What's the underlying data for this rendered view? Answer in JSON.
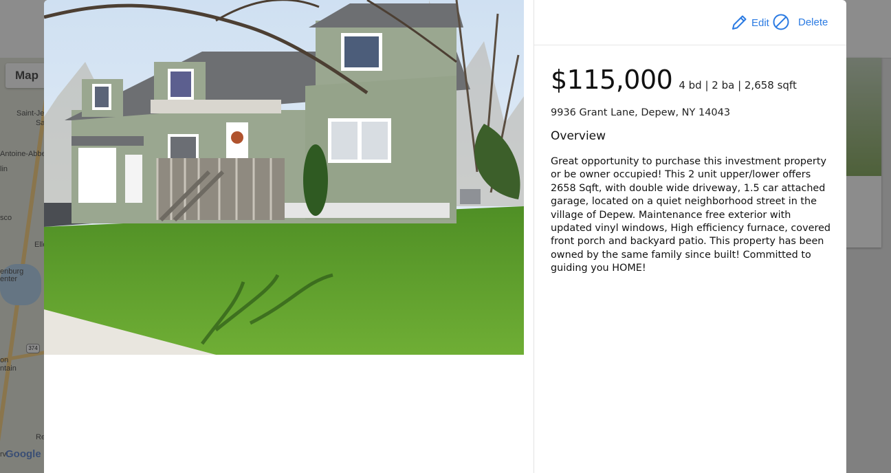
{
  "background": {
    "map_button_label": "Map",
    "map_labels": [
      "Saint-Je",
      "Sa",
      "Antoine-Abbe",
      "lin",
      "sco",
      "Elle",
      "enburg",
      "enter",
      "on",
      "ntain",
      "Re",
      "rvi"
    ],
    "route_shield": "374",
    "google_logo": "Google"
  },
  "modal": {
    "actions": {
      "edit_label": "Edit",
      "delete_label": "Delete"
    },
    "listing": {
      "price": "$115,000",
      "specs": "4 bd | 2 ba | 2,658 sqft",
      "address": "9936 Grant Lane, Depew, NY 14043",
      "overview_heading": "Overview",
      "description": "Great opportunity to purchase this investment property or be owner occupied! This 2 unit upper/lower offers 2658 Sqft, with double wide driveway, 1.5 car attached garage, located on a quiet neighborhood street in the village of Depew. Maintenance free exterior with updated vinyl windows, High efficiency furnace, covered front porch and backyard patio. This property has been owned by the same family since built! Committed to guiding you HOME!"
    }
  },
  "colors": {
    "accent": "#2a7ae2",
    "siding": "#9aa790",
    "lawn": "#5f9a2e",
    "sky": "#dbe8f4"
  }
}
